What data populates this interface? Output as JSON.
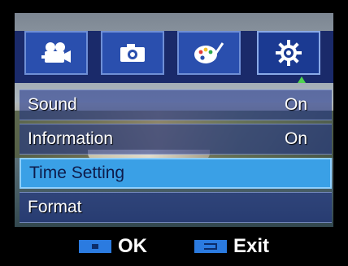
{
  "tabs": [
    {
      "name": "video-mode",
      "icon": "video-camera-icon",
      "selected": false
    },
    {
      "name": "photo-mode",
      "icon": "camera-icon",
      "selected": false
    },
    {
      "name": "effects-mode",
      "icon": "palette-icon",
      "selected": false
    },
    {
      "name": "setup-mode",
      "icon": "gear-icon",
      "selected": true
    }
  ],
  "menu": {
    "items": [
      {
        "label": "Sound",
        "value": "On",
        "selected": false
      },
      {
        "label": "Information",
        "value": "On",
        "selected": false
      },
      {
        "label": "Time Setting",
        "value": "",
        "selected": true
      },
      {
        "label": "Format",
        "value": "",
        "selected": false
      }
    ]
  },
  "footer": {
    "ok_label": "OK",
    "exit_label": "Exit"
  },
  "colors": {
    "tab_bg": "#2a4fae",
    "selected_row": "#3aa0e6",
    "indicator": "#4fd44f"
  }
}
